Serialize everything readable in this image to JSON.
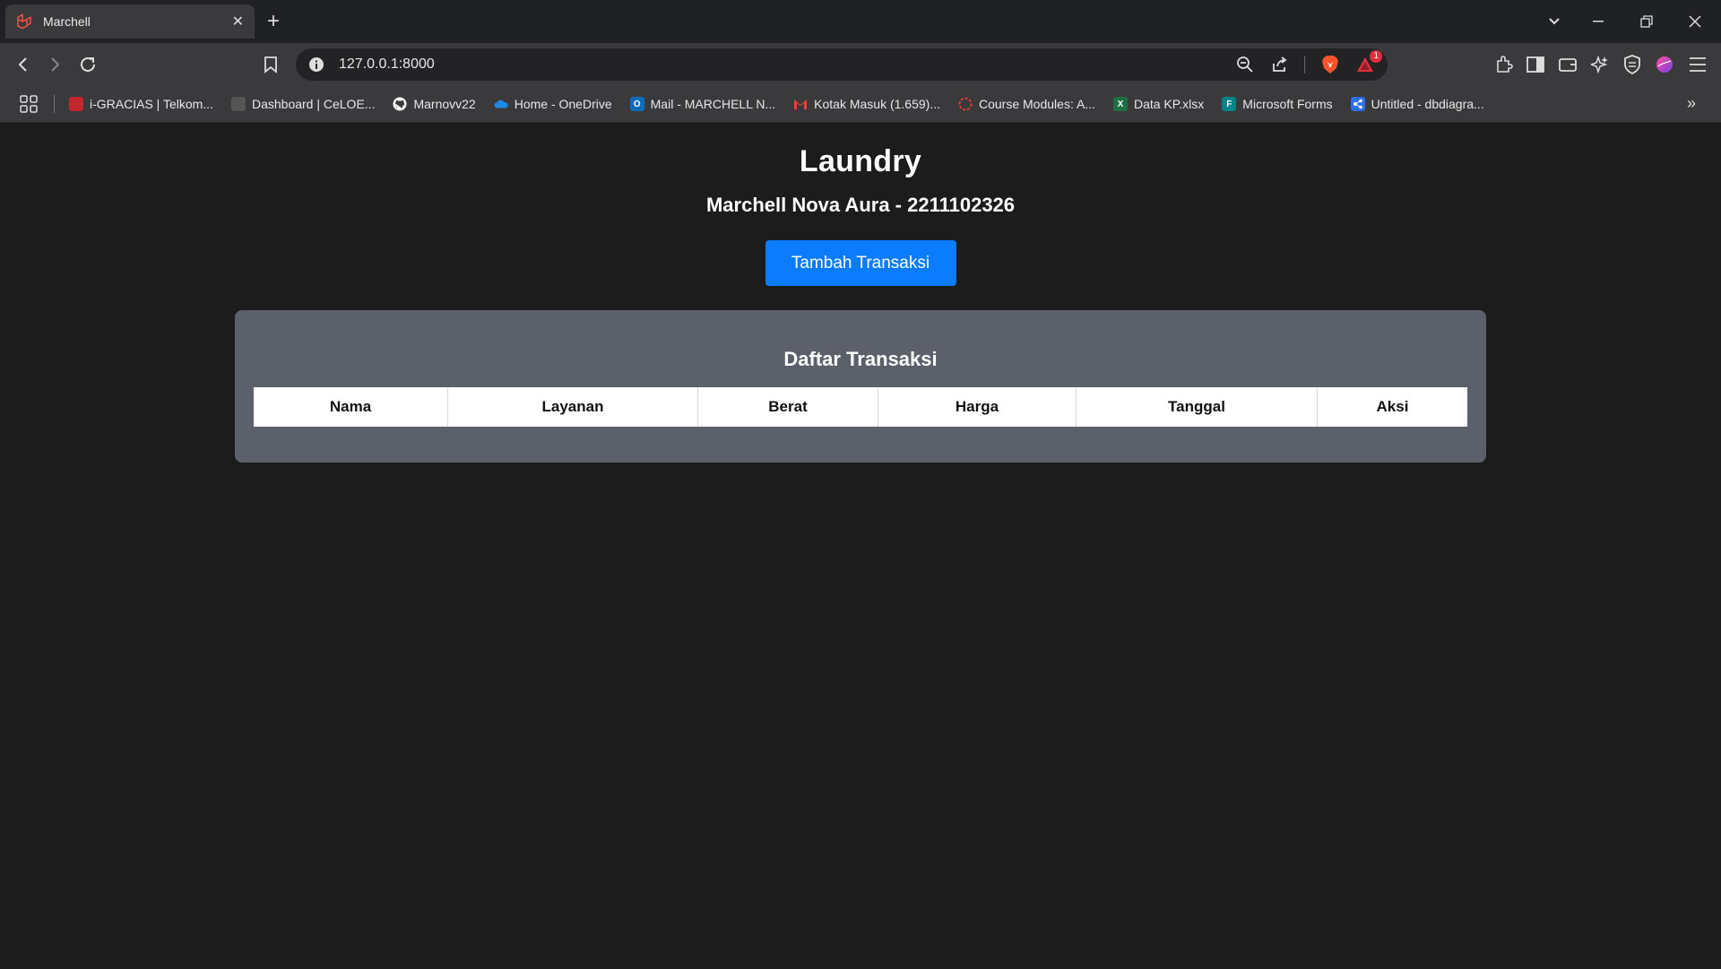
{
  "browser": {
    "tab": {
      "title": "Marchell"
    },
    "address": {
      "url": "127.0.0.1:8000"
    },
    "notification_count": "1",
    "bookmarks": [
      {
        "label": "i-GRACIAS | Telkom...",
        "icon": "telkom-icon",
        "color": "#c0272d"
      },
      {
        "label": "Dashboard | CeLOE...",
        "icon": "celoe-icon",
        "color": "#555555"
      },
      {
        "label": "Marnovv22",
        "icon": "github-icon",
        "color": "#ffffff"
      },
      {
        "label": "Home - OneDrive",
        "icon": "onedrive-icon",
        "color": "#1e88e5"
      },
      {
        "label": "Mail - MARCHELL N...",
        "icon": "outlook-icon",
        "color": "#0f6cbd"
      },
      {
        "label": "Kotak Masuk (1.659)...",
        "icon": "gmail-icon",
        "color": "#ea4335"
      },
      {
        "label": "Course Modules: A...",
        "icon": "course-icon",
        "color": "#e53935"
      },
      {
        "label": "Data KP.xlsx",
        "icon": "excel-icon",
        "color": "#1d6f42"
      },
      {
        "label": "Microsoft Forms",
        "icon": "forms-icon",
        "color": "#038387"
      },
      {
        "label": "Untitled - dbdiagra...",
        "icon": "dbdiagram-icon",
        "color": "#2f6fe4"
      }
    ]
  },
  "page": {
    "title": "Laundry",
    "subtitle": "Marchell Nova Aura - 2211102326",
    "add_button": "Tambah Transaksi",
    "card_title": "Daftar Transaksi",
    "columns": [
      "Nama",
      "Layanan",
      "Berat",
      "Harga",
      "Tanggal",
      "Aksi"
    ]
  },
  "colors": {
    "accent": "#0b7bff",
    "card": "#5b606b",
    "background": "#1c1c1d"
  }
}
